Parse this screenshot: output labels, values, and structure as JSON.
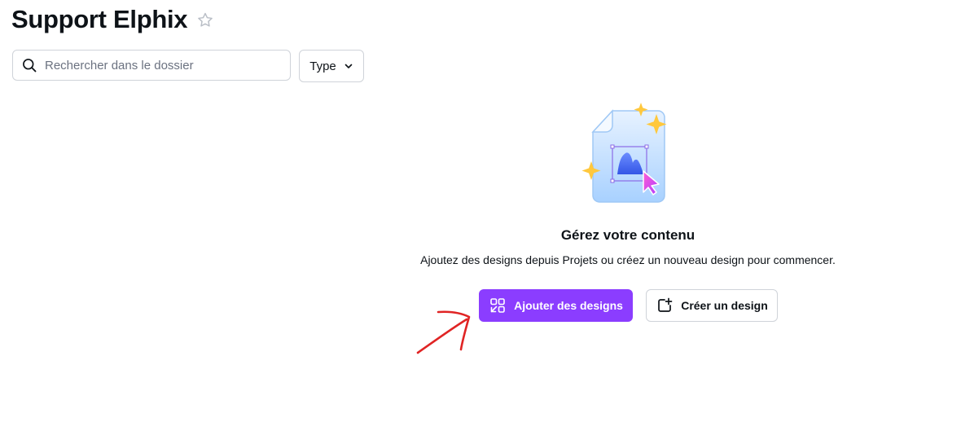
{
  "page": {
    "title": "Support Elphix"
  },
  "toolbar": {
    "search_placeholder": "Rechercher dans le dossier",
    "search_value": "",
    "type_filter_label": "Type"
  },
  "empty_state": {
    "title": "Gérez votre contenu",
    "subtitle": "Ajoutez des designs depuis Projets ou créez un nouveau design pour commencer.",
    "add_designs_label": "Ajouter des designs",
    "create_design_label": "Créer un design"
  },
  "icons": {
    "favorite": "star-outline-icon",
    "search": "search-icon",
    "filter_chevron": "chevron-down-icon",
    "add_designs": "add-designs-icon",
    "create_design": "create-design-icon"
  },
  "colors": {
    "primary": "#8b3dff",
    "border": "#cfd3d9",
    "text": "#0e1318",
    "placeholder": "#6b7280",
    "annotation": "#e02424"
  }
}
